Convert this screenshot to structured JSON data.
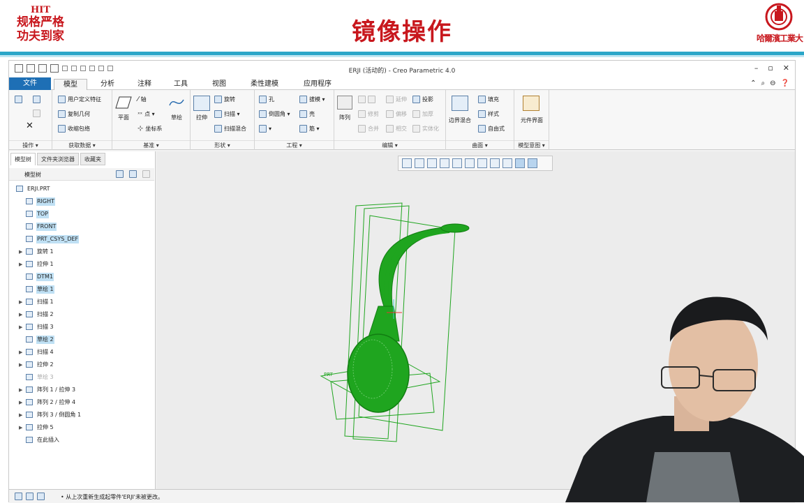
{
  "slide": {
    "logo_abbr": "HIT",
    "logo_line1": "规格严格",
    "logo_line2": "功夫到家",
    "title": "镜像操作",
    "university_name": "哈爾濱工業大"
  },
  "window": {
    "title": "ERJI (活动的) - Creo Parametric 4.0",
    "controls": [
      "–",
      "▫",
      "✕"
    ]
  },
  "tabs": [
    "文件",
    "模型",
    "分析",
    "注释",
    "工具",
    "视图",
    "柔性建模",
    "应用程序"
  ],
  "active_tab": "模型",
  "ribbon": {
    "ops": {
      "footer": "操作 ▾"
    },
    "getdata": {
      "items": [
        "用户定义特征",
        "复制几何",
        "收缩包络"
      ],
      "footer": "获取数据 ▾"
    },
    "datum": {
      "plane": "平面",
      "axis": "轴",
      "point": "点 ▾",
      "csys": "坐标系",
      "sketch": "草绘",
      "footer": "基准 ▾"
    },
    "shapes": {
      "extrude": "拉伸",
      "revolve": "旋转",
      "sweep": "扫描 ▾",
      "swept_blend": "扫描混合",
      "footer": "形状 ▾"
    },
    "engineering": {
      "hole": "孔",
      "draft": "拔模 ▾",
      "round": "倒圆角 ▾",
      "shell": "壳",
      "rib": "筋 ▾",
      "footer": "工程 ▾"
    },
    "editing": {
      "pattern": "阵列",
      "mirror": "",
      "extend": "延伸",
      "project": "投影",
      "trim": "修剪",
      "offset": "偏移",
      "thicken": "加厚",
      "merge": "合并",
      "intersect": "相交",
      "solidify": "实体化",
      "footer": "编辑 ▾"
    },
    "surfaces": {
      "boundary_blend": "边界混合",
      "fill": "填充",
      "style": "样式",
      "freestyle": "自由式",
      "footer": "曲面 ▾"
    },
    "model_intent": {
      "component_interface": "元件界面",
      "footer": "模型意图 ▾"
    }
  },
  "panel": {
    "tabs": [
      "模型树",
      "文件夹浏览器",
      "收藏夹"
    ],
    "header": "模型树"
  },
  "tree": [
    {
      "label": "ERJI.PRT",
      "hl": false,
      "dim": false,
      "expandable": false,
      "indent": 0
    },
    {
      "label": "RIGHT",
      "hl": true,
      "dim": false,
      "expandable": false,
      "indent": 1
    },
    {
      "label": "TOP",
      "hl": true,
      "dim": false,
      "expandable": false,
      "indent": 1
    },
    {
      "label": "FRONT",
      "hl": true,
      "dim": false,
      "expandable": false,
      "indent": 1
    },
    {
      "label": "PRT_CSYS_DEF",
      "hl": true,
      "dim": false,
      "expandable": false,
      "indent": 1
    },
    {
      "label": "旋转 1",
      "hl": false,
      "dim": false,
      "expandable": true,
      "indent": 1
    },
    {
      "label": "拉伸 1",
      "hl": false,
      "dim": false,
      "expandable": true,
      "indent": 1
    },
    {
      "label": "DTM1",
      "hl": true,
      "dim": false,
      "expandable": false,
      "indent": 1
    },
    {
      "label": "草绘 1",
      "hl": true,
      "dim": false,
      "expandable": false,
      "indent": 1
    },
    {
      "label": "扫描 1",
      "hl": false,
      "dim": false,
      "expandable": true,
      "indent": 1
    },
    {
      "label": "扫描 2",
      "hl": false,
      "dim": false,
      "expandable": true,
      "indent": 1
    },
    {
      "label": "扫描 3",
      "hl": false,
      "dim": false,
      "expandable": true,
      "indent": 1
    },
    {
      "label": "草绘 2",
      "hl": true,
      "dim": false,
      "expandable": false,
      "indent": 1
    },
    {
      "label": "扫描 4",
      "hl": false,
      "dim": false,
      "expandable": true,
      "indent": 1
    },
    {
      "label": "拉伸 2",
      "hl": false,
      "dim": false,
      "expandable": true,
      "indent": 1
    },
    {
      "label": "草绘 3",
      "hl": false,
      "dim": true,
      "expandable": false,
      "indent": 1
    },
    {
      "label": "阵列 1 / 拉伸 3",
      "hl": false,
      "dim": false,
      "expandable": true,
      "indent": 1
    },
    {
      "label": "阵列 2 / 拉伸 4",
      "hl": false,
      "dim": false,
      "expandable": true,
      "indent": 1
    },
    {
      "label": "阵列 3 / 倒圆角 1",
      "hl": false,
      "dim": false,
      "expandable": true,
      "indent": 1
    },
    {
      "label": "拉伸 5",
      "hl": false,
      "dim": false,
      "expandable": true,
      "indent": 1
    },
    {
      "label": "在此插入",
      "hl": false,
      "dim": false,
      "expandable": false,
      "indent": 1
    }
  ],
  "viewport": {
    "plane_label": "PRT",
    "model_color": "#1fa51f"
  },
  "status": {
    "message": "• 从上次重新生成起零件'ERJI'未被更改。"
  }
}
